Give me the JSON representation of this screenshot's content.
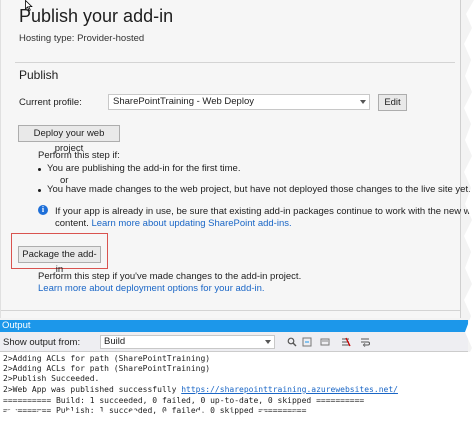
{
  "publish_page": {
    "title": "Publish your add-in",
    "hosting": "Hosting type: Provider-hosted",
    "section_title": "Publish",
    "profile_label": "Current profile:",
    "profile_value": "SharePointTraining - Web Deploy",
    "edit_label": "Edit",
    "deploy_button": "Deploy your web project",
    "perform_first": "Perform this step if:",
    "bullet1": "You are publishing the add-in for the first time.",
    "or_text": "or",
    "bullet2": "You have made changes to the web project, but have not deployed those changes to the live site yet.",
    "info_line1": "If your app is already in use, be sure that existing add-in packages continue to work with the new web",
    "info_line2_prefix": "content.",
    "info_link": "Learn more about updating SharePoint add-ins.",
    "package_button": "Package the add-in",
    "perform_second": "Perform this step if you've made changes to the add-in project.",
    "deploy_link": "Learn more about deployment options for your add-in."
  },
  "output_panel": {
    "title": "Output",
    "show_from_label": "Show output from:",
    "source_value": "Build",
    "lines": [
      "2>Adding ACLs for path (SharePointTraining)",
      "2>Adding ACLs for path (SharePointTraining)",
      "2>Publish Succeeded."
    ],
    "web_app_prefix": "2>Web App was published successfully ",
    "web_app_link": "https://sharepointtraining.azurewebsites.net/",
    "build_line": "========== Build: 1 succeeded, 0 failed, 0 up-to-date, 0 skipped ==========",
    "publish_line": "========== Publish: 1 succeeded, 0 failed, 0 skipped =========="
  },
  "colors": {
    "accent": "#1c97ea",
    "link": "#1a66c6",
    "highlight_box": "#d9534f"
  },
  "icons": [
    "cursor-icon",
    "info-icon",
    "dropdown-arrow-icon",
    "find-icon",
    "clear-all-icon",
    "word-wrap-icon"
  ]
}
